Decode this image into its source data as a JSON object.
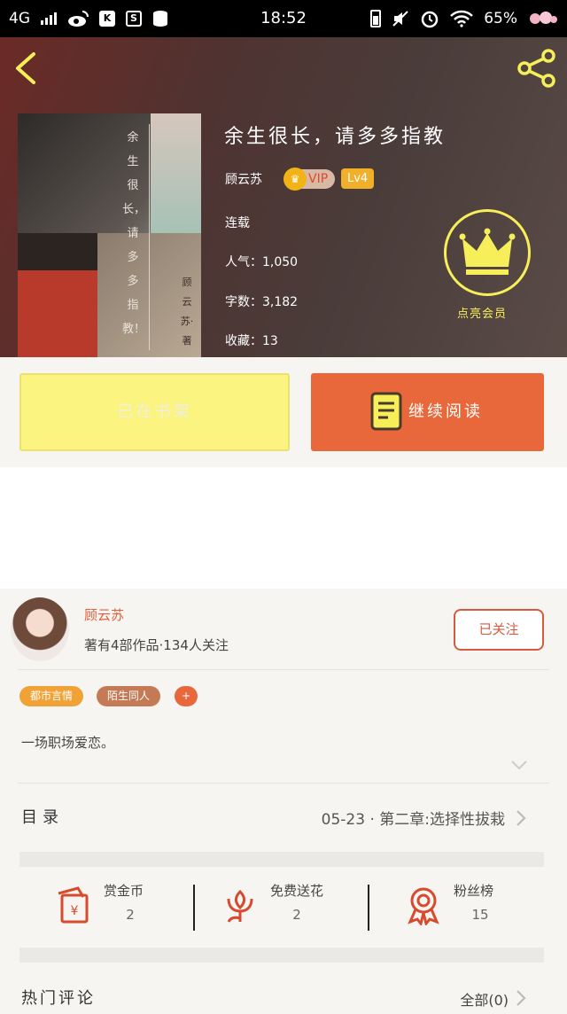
{
  "status_bar": {
    "network": "4G",
    "time": "18:52",
    "battery": "65%",
    "icons": [
      "signal-icon",
      "weibo-icon",
      "k-icon",
      "s-icon",
      "database-icon",
      "charging-icon",
      "mute-icon",
      "alarm-icon",
      "wifi-icon",
      "flower-icon"
    ]
  },
  "header": {
    "back_icon": "chevron-left-icon",
    "share_icon": "share-icon"
  },
  "book": {
    "cover_title_vertical": "余生很长，请多多指教！",
    "cover_author_vertical": "顾云苏·著",
    "title": "余生很长，请多多指教",
    "author": "顾云苏",
    "vip_label": "VIP",
    "level": "Lv4",
    "status": "连载",
    "popularity_label": "人气：",
    "popularity": "1,050",
    "words_label": "字数：",
    "words": "3,182",
    "favorites_label": "收藏：",
    "favorites": "13",
    "member_label": "点亮会员"
  },
  "actions": {
    "shelf_label": "已在书架",
    "read_label": "继续阅读"
  },
  "author_card": {
    "name": "顾云苏",
    "info": "著有4部作品·134人关注",
    "follow_label": "已关注"
  },
  "tags": [
    {
      "label": "都市言情",
      "color": "#f0a236"
    },
    {
      "label": "陌生同人",
      "color": "#c47a55"
    },
    {
      "label": "+",
      "color": "#e8683b"
    }
  ],
  "intro": "一场职场爱恋。",
  "toc": {
    "label": "目录",
    "latest": "05-23 · 第二章:选择性拔栽"
  },
  "stats": [
    {
      "label": "赏金币",
      "value": "2",
      "icon": "red-envelope-icon"
    },
    {
      "label": "免费送花",
      "value": "2",
      "icon": "flower-icon"
    },
    {
      "label": "粉丝榜",
      "value": "15",
      "icon": "award-ribbon-icon"
    }
  ],
  "comments": {
    "label": "热门评论",
    "all_label": "全部(0)"
  },
  "colors": {
    "accent_orange": "#e8683b",
    "shelf_yellow": "#fbf481",
    "crown_yellow": "#f7ef5a",
    "author_name": "#e45f39"
  }
}
